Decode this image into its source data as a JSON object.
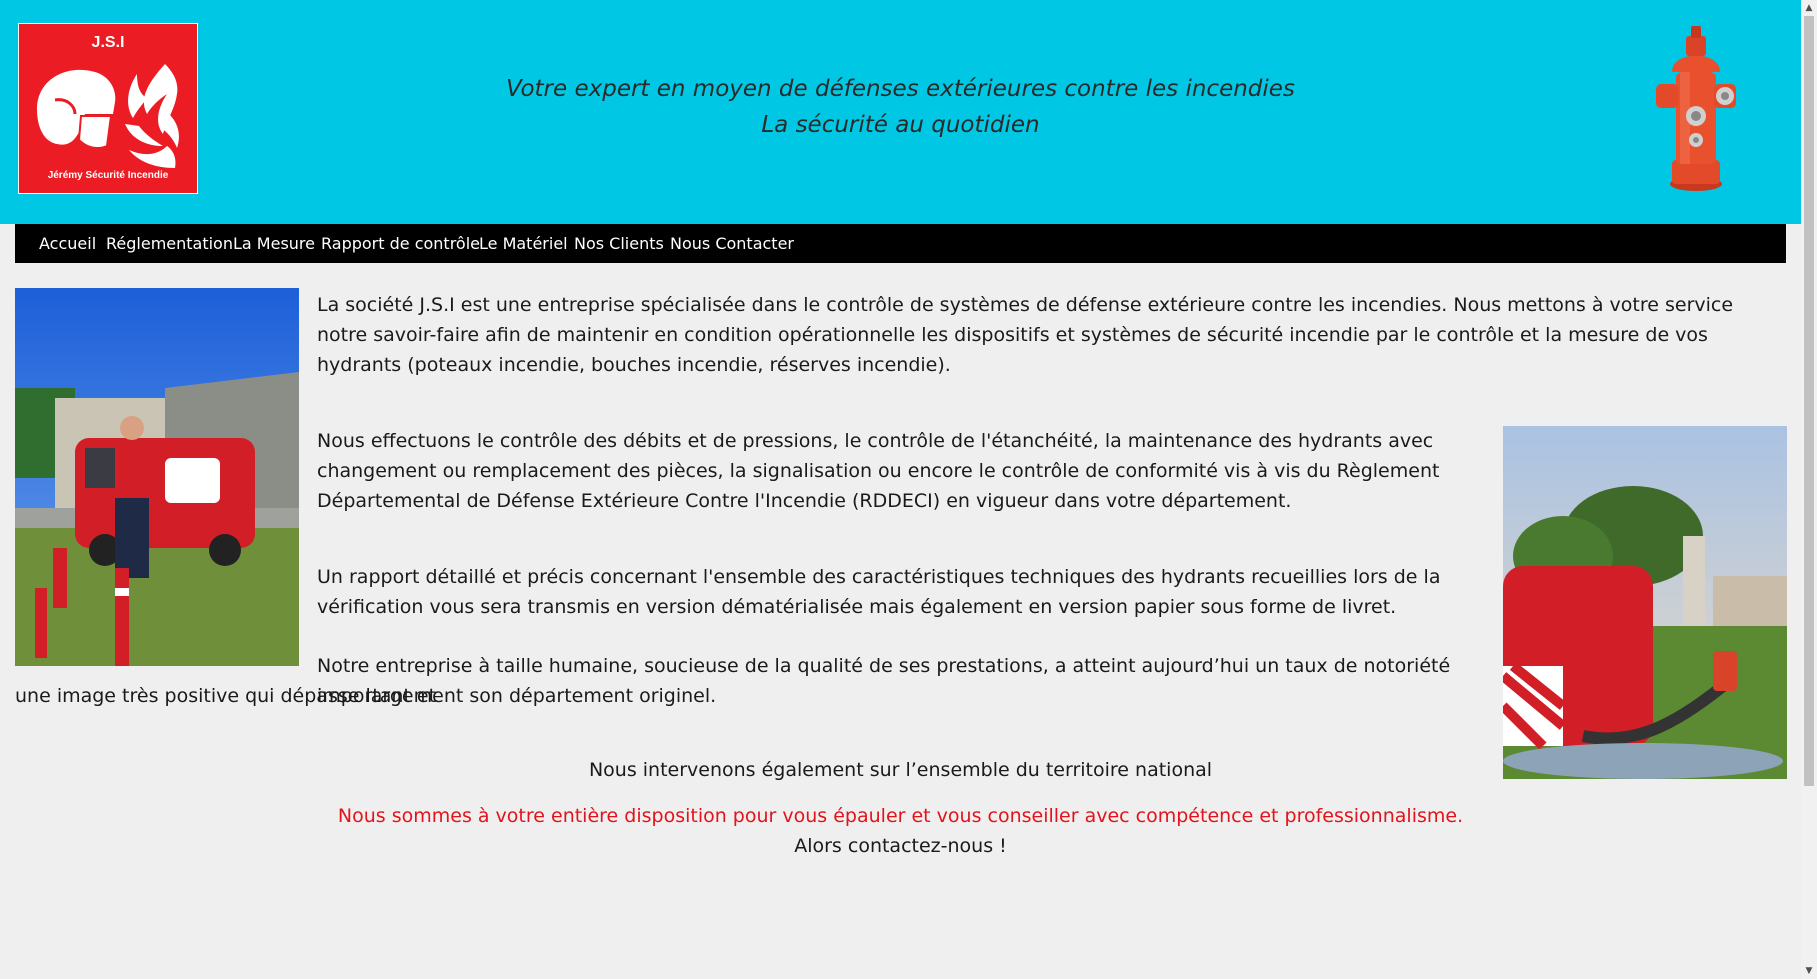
{
  "header": {
    "logo_title": "J.S.I",
    "logo_subtitle": "Jérémy Sécurité Incendie",
    "tagline_1": "Votre expert en moyen de défenses extérieures contre les incendies",
    "tagline_2": "La sécurité au quotidien"
  },
  "nav": {
    "items": [
      "Accueil",
      "Réglementation",
      "La Mesure",
      "Rapport de contrôle",
      "Le Matériel",
      "Nos Clients",
      "Nous Contacter"
    ]
  },
  "content": {
    "para_1": "La société J.S.I est une entreprise spécialisée dans le contrôle de systèmes de défense extérieure contre les incendies. Nous mettons à votre service notre savoir-faire afin de maintenir en condition opérationnelle les dispositifs et systèmes de sécurité incendie par le contrôle et la mesure de vos hydrants (poteaux incendie, bouches incendie, réserves incendie).",
    "para_2": "Nous effectuons le contrôle des débits et de pressions, le contrôle de l'étanchéité, la maintenance des hydrants avec changement ou remplacement des pièces, la signalisation ou encore le contrôle de conformité vis à vis du Règlement Départemental de Défense Extérieure Contre l'Incendie (RDDECI) en vigueur dans votre département.",
    "para_3": "Un rapport détaillé et précis concernant l'ensemble des caractéristiques techniques des hydrants recueillies lors de la vérification vous sera transmis en version dématérialisée mais également en version papier sous forme de livret.",
    "para_4a": "Notre entreprise à taille humaine, soucieuse de la qualité de ses prestations, a atteint aujourd’hui un taux de notoriété important et",
    "para_4b": "une image très positive qui dépasse largement son département originel.",
    "national": "Nous intervenons également sur l’ensemble du territoire national",
    "disposition": "Nous sommes à votre entière disposition pour vous épauler et vous conseiller avec compétence et professionnalisme.",
    "cta": "Alors contactez-nous !"
  },
  "colors": {
    "header_bg": "#00c8e4",
    "nav_bg": "#000000",
    "brand_red": "#ec1c24",
    "page_bg": "#efefef",
    "highlight_text": "#e3131b"
  },
  "icons": {
    "logo": "firefighter-helmet-flames-icon",
    "hydrant": "fire-hydrant-icon"
  }
}
